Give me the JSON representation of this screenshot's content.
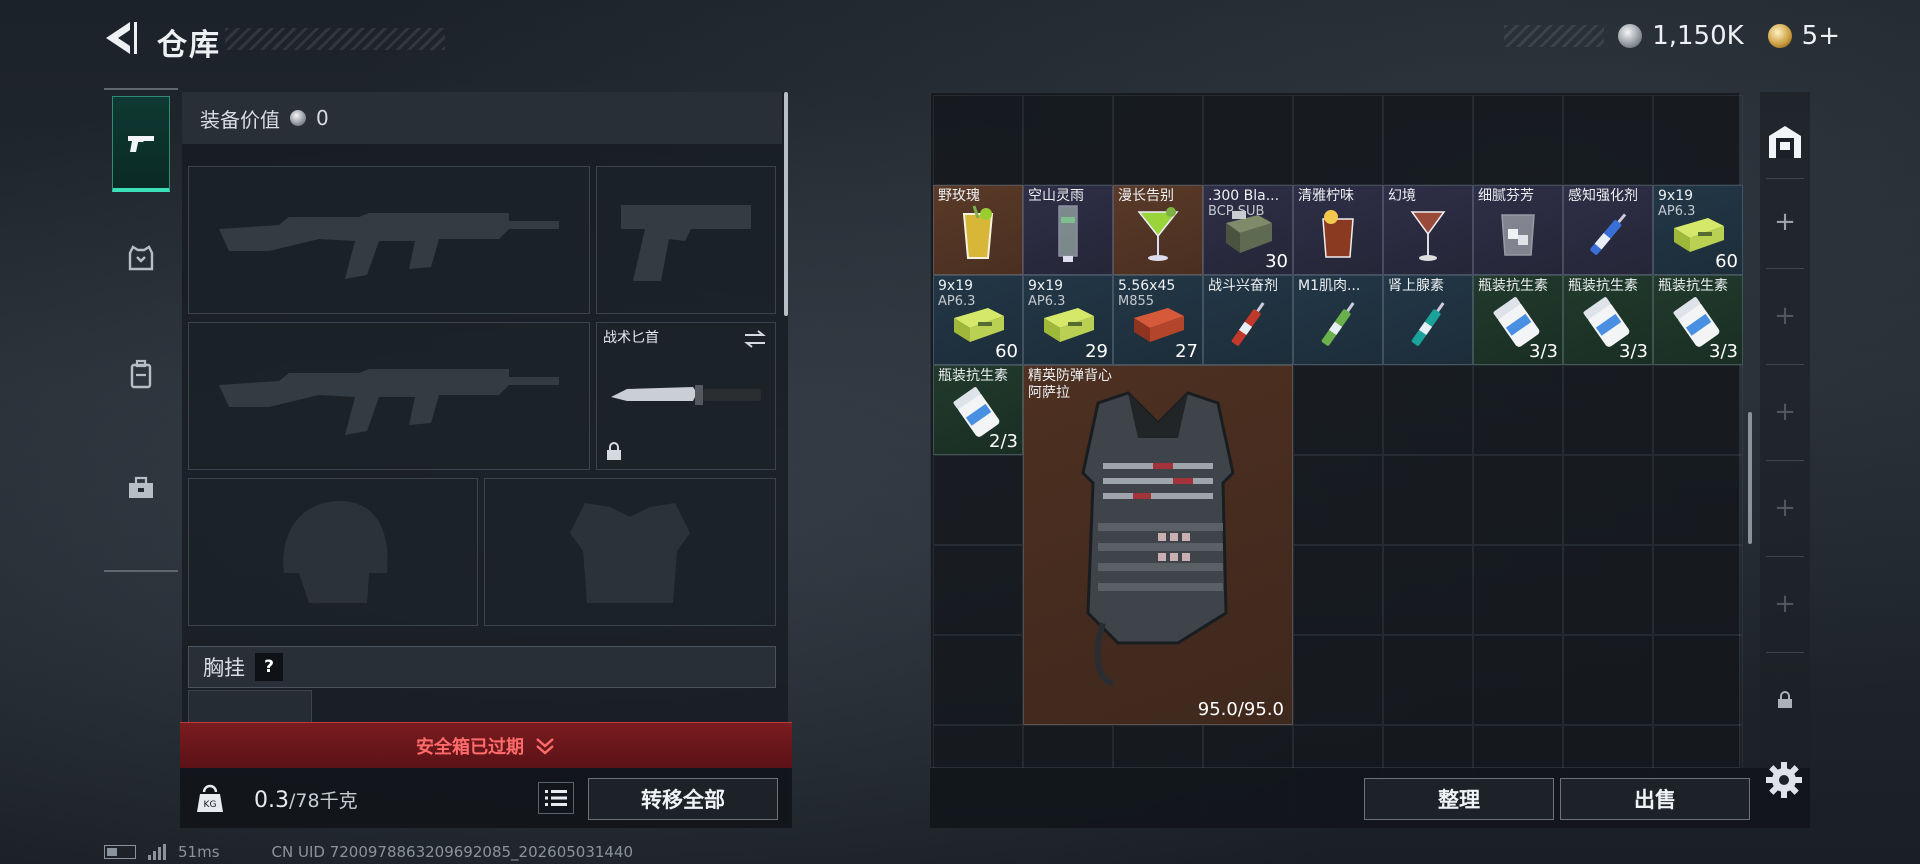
{
  "header": {
    "title": "仓库",
    "currency": [
      {
        "icon": "silver-coin-icon",
        "value": "1,150K"
      },
      {
        "icon": "gold-coin-icon",
        "value": "5+"
      }
    ]
  },
  "tabs": [
    {
      "name": "weapon-tab",
      "icon": "pistol-icon",
      "active": true
    },
    {
      "name": "armor-tab",
      "icon": "armor-icon",
      "active": false
    },
    {
      "name": "backpack-tab",
      "icon": "backpack-icon",
      "active": false
    },
    {
      "name": "toolbox-tab",
      "icon": "toolbox-icon",
      "active": false
    }
  ],
  "equipment": {
    "value_label": "装备价值",
    "value": "0",
    "knife_label": "战术匕首",
    "chest_label": "胸挂",
    "help": "?",
    "expired": "安全箱已过期",
    "weight_value": "0.3",
    "weight_max": "/78千克",
    "transfer_all": "转移全部"
  },
  "inventory": {
    "items": [
      {
        "name": "野玫瑰",
        "sub": "",
        "count": "",
        "color": "orange",
        "icon": "cocktail-yellow"
      },
      {
        "name": "空山灵雨",
        "sub": "",
        "count": "",
        "color": "purple",
        "icon": "cocktail-tall"
      },
      {
        "name": "漫长告别",
        "sub": "",
        "count": "",
        "color": "orange",
        "icon": "cocktail-green"
      },
      {
        "name": ".300 Bla...",
        "sub": "BCP SUB",
        "count": "30",
        "color": "purple",
        "icon": "ammo-box-dark"
      },
      {
        "name": "清雅柠味",
        "sub": "",
        "count": "",
        "color": "purple",
        "icon": "cocktail-brown"
      },
      {
        "name": "幻境",
        "sub": "",
        "count": "",
        "color": "purple",
        "icon": "cocktail-martini"
      },
      {
        "name": "细腻芬芳",
        "sub": "",
        "count": "",
        "color": "purple",
        "icon": "glass-ice"
      },
      {
        "name": "感知强化剂",
        "sub": "",
        "count": "",
        "color": "purple",
        "icon": "syringe-blue"
      },
      {
        "name": "9x19",
        "sub": "AP6.3",
        "count": "60",
        "color": "blue",
        "icon": "ammo-box-green"
      },
      {
        "name": "9x19",
        "sub": "AP6.3",
        "count": "60",
        "color": "blue",
        "icon": "ammo-box-green"
      },
      {
        "name": "9x19",
        "sub": "AP6.3",
        "count": "29",
        "color": "blue",
        "icon": "ammo-box-green"
      },
      {
        "name": "5.56x45",
        "sub": "M855",
        "count": "27",
        "color": "blue",
        "icon": "ammo-box-red"
      },
      {
        "name": "战斗兴奋剂",
        "sub": "",
        "count": "",
        "color": "blue",
        "icon": "syringe-red"
      },
      {
        "name": "M1肌肉...",
        "sub": "",
        "count": "",
        "color": "blue",
        "icon": "syringe-green"
      },
      {
        "name": "肾上腺素",
        "sub": "",
        "count": "",
        "color": "blue",
        "icon": "syringe-teal"
      },
      {
        "name": "瓶装抗生素",
        "sub": "",
        "count": "3/3",
        "color": "green",
        "icon": "pill-bottle"
      },
      {
        "name": "瓶装抗生素",
        "sub": "",
        "count": "3/3",
        "color": "green",
        "icon": "pill-bottle"
      },
      {
        "name": "瓶装抗生素",
        "sub": "",
        "count": "3/3",
        "color": "green",
        "icon": "pill-bottle"
      },
      {
        "name": "瓶装抗生素",
        "sub": "",
        "count": "2/3",
        "color": "green",
        "icon": "pill-bottle"
      }
    ],
    "vest": {
      "name": "精英防弹背心",
      "sub": "阿萨拉",
      "durability": "95.0/95.0"
    },
    "sort": "整理",
    "sell": "出售"
  },
  "status": {
    "ping": "51ms",
    "uid": "CN UID 7200978863209692085_202605031440"
  }
}
